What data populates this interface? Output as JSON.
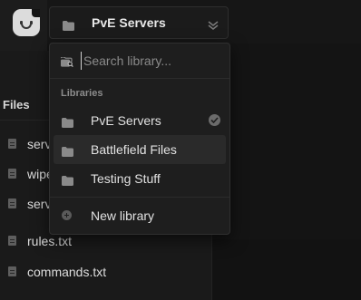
{
  "app": {
    "logo_icon": "app-logo-icon"
  },
  "library_selector": {
    "current": "PvE Servers",
    "icon": "folder-icon",
    "chevron": "chevron-down-icon"
  },
  "files_panel": {
    "header": "Files",
    "items": [
      {
        "name": "serv"
      },
      {
        "name": "wipe"
      },
      {
        "name": "serv"
      },
      {
        "name": "rules.txt"
      },
      {
        "name": "commands.txt"
      }
    ]
  },
  "dropdown": {
    "search_placeholder": "Search library...",
    "search_value": "",
    "section_label": "Libraries",
    "libraries": [
      {
        "label": "PvE Servers",
        "selected": true
      },
      {
        "label": "Battlefield Files",
        "selected": false
      },
      {
        "label": "Testing Stuff",
        "selected": false
      }
    ],
    "new_library_label": "New library"
  },
  "colors": {
    "background": "#141414",
    "panel": "#1e1e1e",
    "hover": "#2a2a2a",
    "text": "#e2e2e2",
    "muted": "#8c8c8c"
  }
}
